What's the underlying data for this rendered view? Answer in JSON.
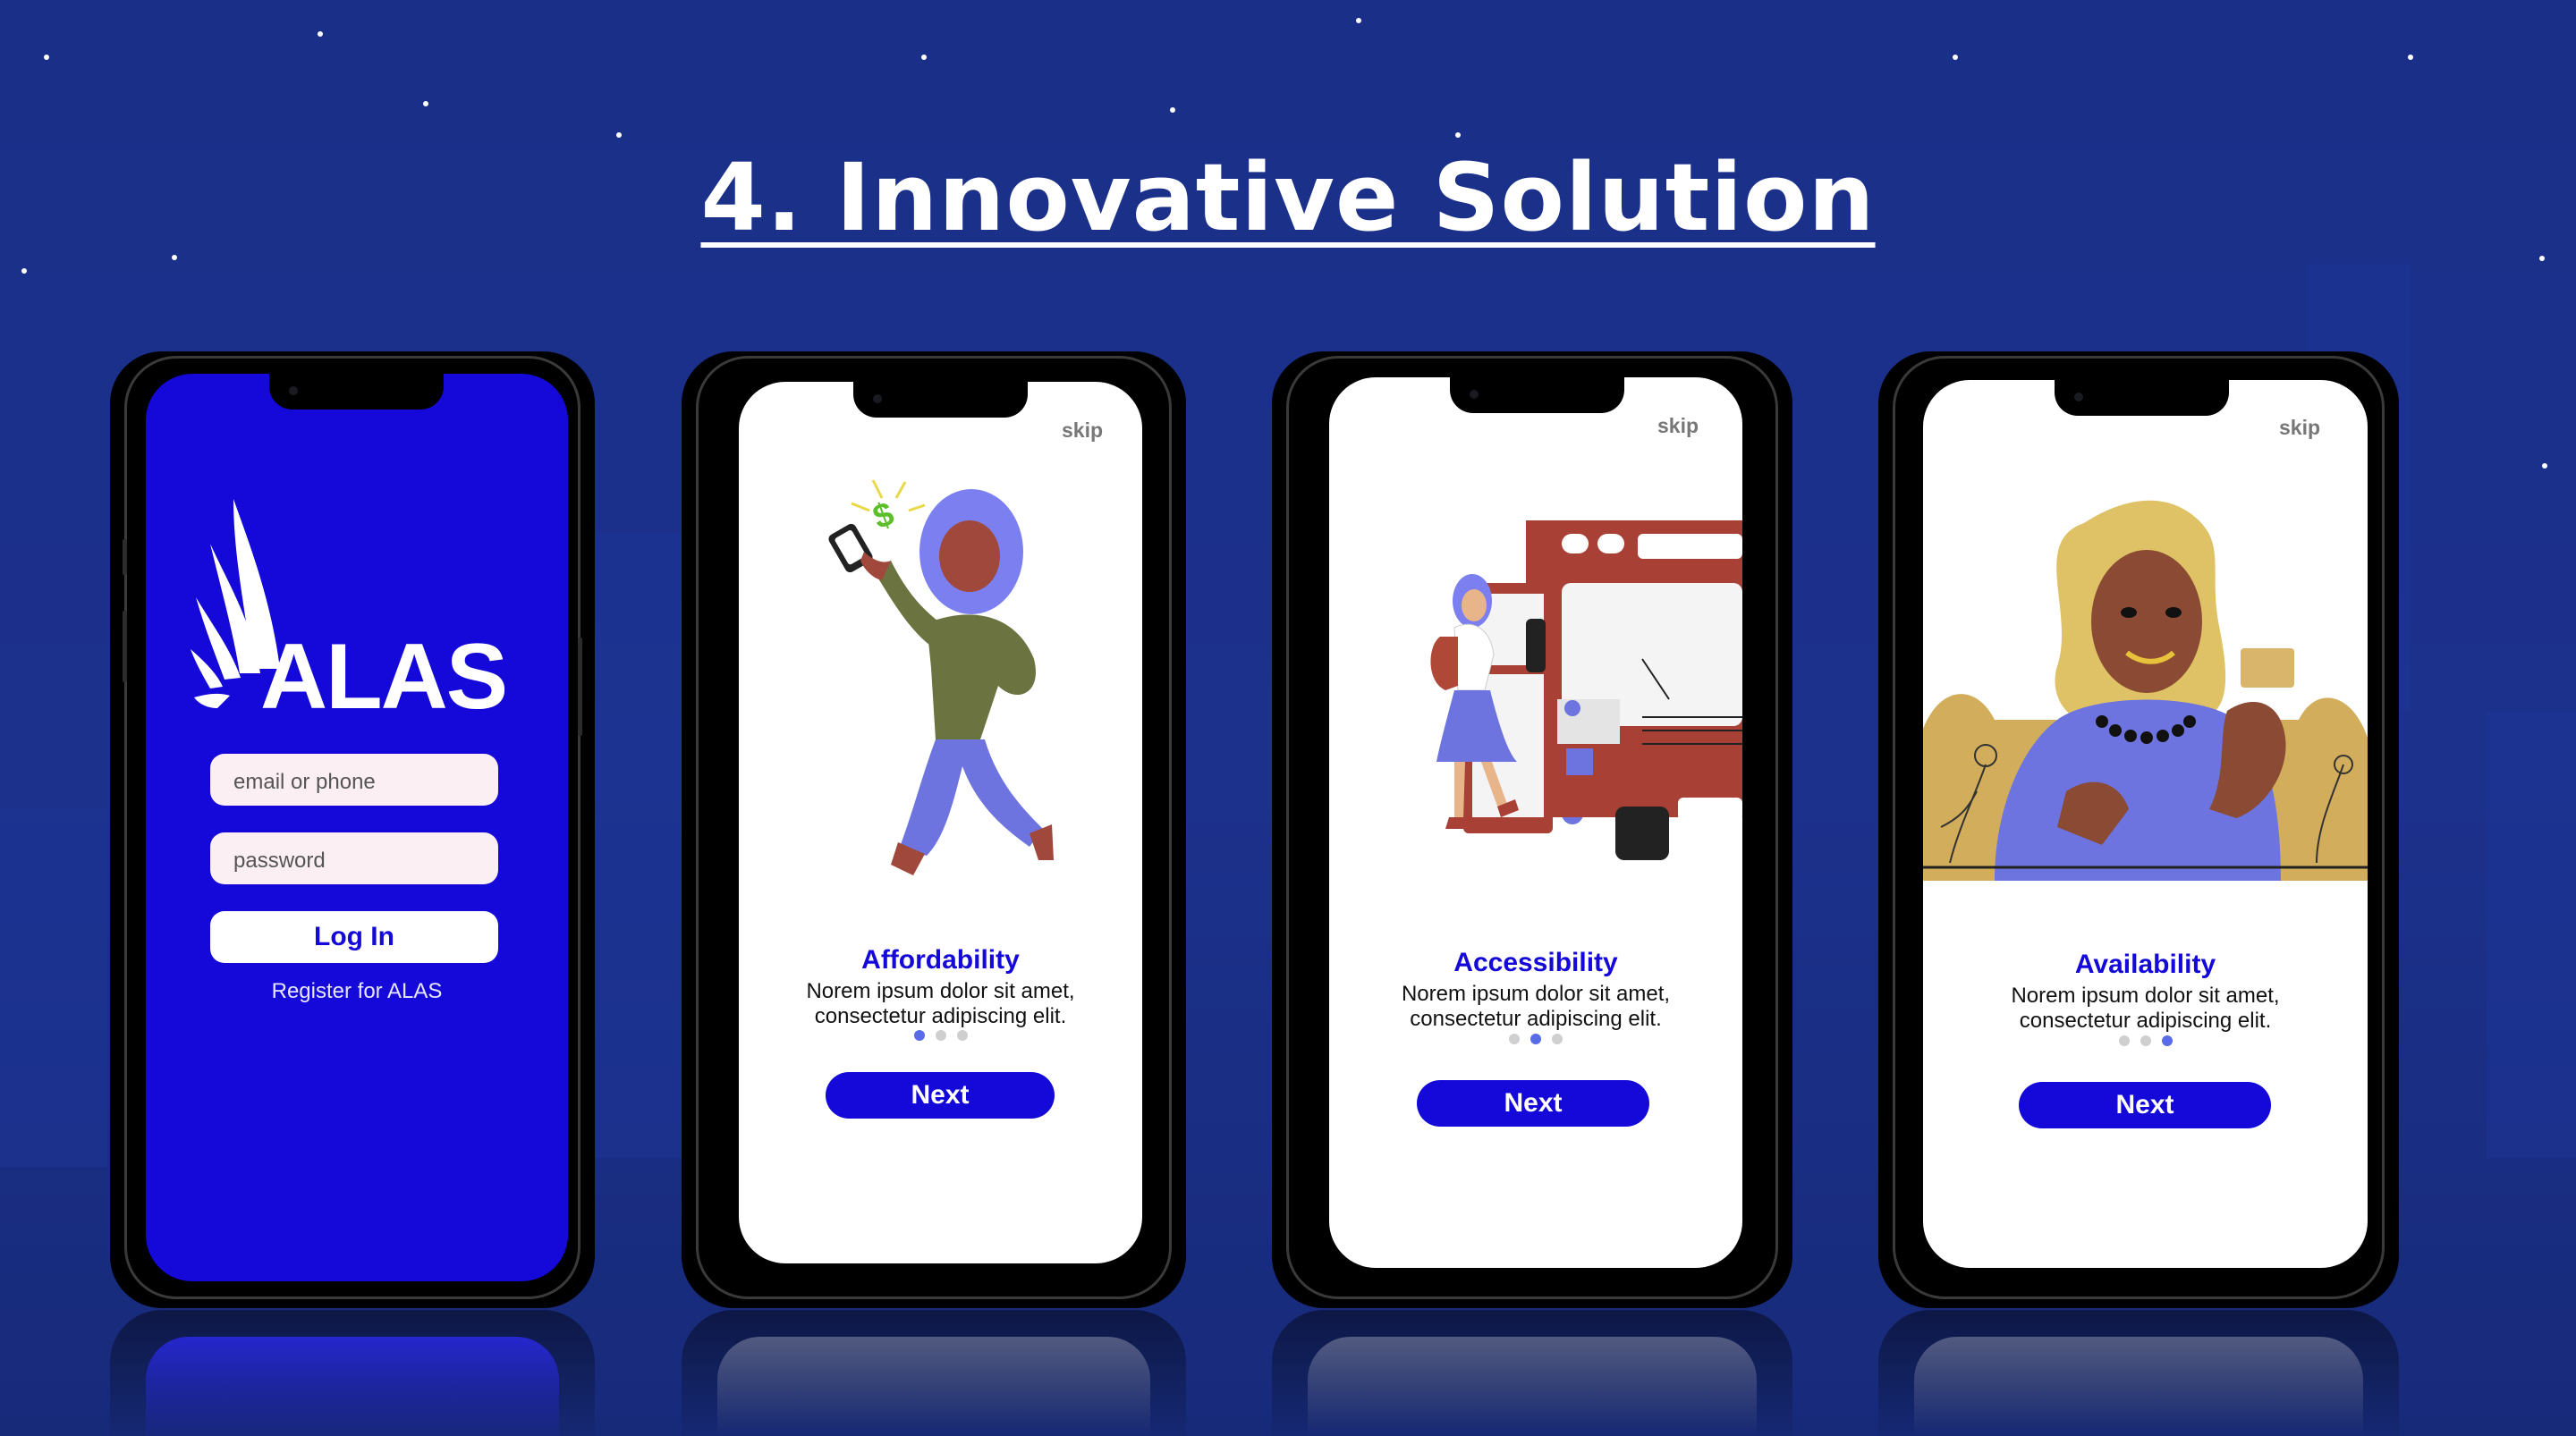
{
  "slide": {
    "title": "4. Innovative Solution"
  },
  "colors": {
    "background": "#1b2f8a",
    "brand_blue": "#1409d8",
    "dot_active": "#5a6be8",
    "dot_inactive": "#cfcfcf"
  },
  "login": {
    "logo_text": "ALAS",
    "email_placeholder": "email or phone",
    "password_placeholder": "password",
    "login_label": "Log In",
    "register_label": "Register for ALAS"
  },
  "onboarding": [
    {
      "skip_label": "skip",
      "title": "Affordability",
      "body_line1": "Norem ipsum dolor sit amet,",
      "body_line2": "consectetur adipiscing elit.",
      "active_dot": 1,
      "next_label": "Next",
      "illustration": "woman-with-phone-money"
    },
    {
      "skip_label": "skip",
      "title": "Accessibility",
      "body_line1": "Norem ipsum dolor sit amet,",
      "body_line2": "consectetur adipiscing elit.",
      "active_dot": 2,
      "next_label": "Next",
      "illustration": "girl-boarding-bus"
    },
    {
      "skip_label": "skip",
      "title": "Availability",
      "body_line1": "Norem ipsum dolor sit amet,",
      "body_line2": "consectetur adipiscing elit.",
      "active_dot": 3,
      "next_label": "Next",
      "illustration": "woman-with-cup"
    }
  ]
}
